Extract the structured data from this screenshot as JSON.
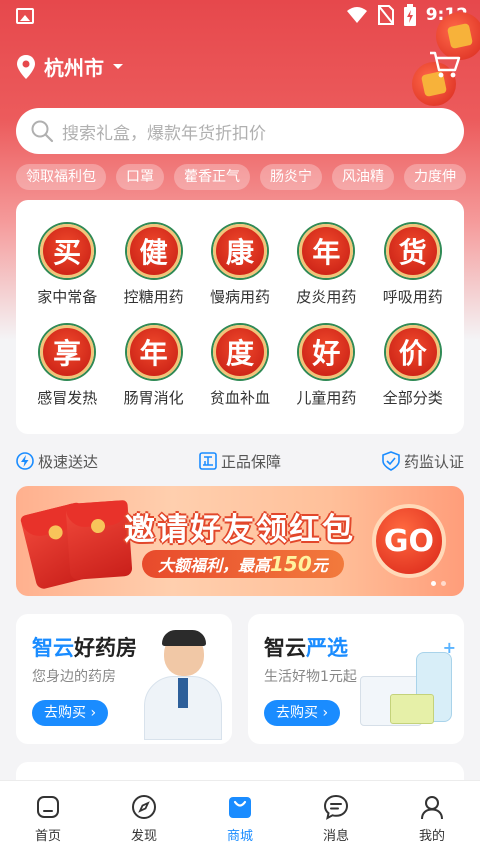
{
  "status_bar": {
    "time": "9:12"
  },
  "header": {
    "city": "杭州市"
  },
  "search": {
    "placeholder": "搜索礼盒，爆款年货折扣价"
  },
  "hot_tags": [
    "领取福利包",
    "口罩",
    "藿香正气",
    "肠炎宁",
    "风油精",
    "力度伸"
  ],
  "categories": [
    {
      "badge": "买",
      "label": "家中常备"
    },
    {
      "badge": "健",
      "label": "控糖用药"
    },
    {
      "badge": "康",
      "label": "慢病用药"
    },
    {
      "badge": "年",
      "label": "皮炎用药"
    },
    {
      "badge": "货",
      "label": "呼吸用药"
    },
    {
      "badge": "享",
      "label": "感冒发热"
    },
    {
      "badge": "年",
      "label": "肠胃消化"
    },
    {
      "badge": "度",
      "label": "贫血补血"
    },
    {
      "badge": "好",
      "label": "儿童用药"
    },
    {
      "badge": "价",
      "label": "全部分类"
    }
  ],
  "guarantees": [
    "极速送达",
    "正品保障",
    "药监认证"
  ],
  "banner": {
    "title": "邀请好友领红包",
    "subtitle_prefix": "大额福利，最高",
    "subtitle_amount": "150",
    "subtitle_unit": "元",
    "go_label": "GO"
  },
  "promos": [
    {
      "title_blue": "智云",
      "title_dark": "好药房",
      "desc": "您身边的药房",
      "button": "去购买"
    },
    {
      "title_dark": "智云",
      "title_blue": "严选",
      "desc": "生活好物1元起",
      "button": "去购买"
    }
  ],
  "tabs": [
    {
      "label": "首页",
      "icon": "home-icon"
    },
    {
      "label": "发现",
      "icon": "compass-icon"
    },
    {
      "label": "商城",
      "icon": "shopping-bag-icon"
    },
    {
      "label": "消息",
      "icon": "message-icon"
    },
    {
      "label": "我的",
      "icon": "user-icon"
    }
  ],
  "colors": {
    "accent": "#1a8cff",
    "brand_red": "#e6484c",
    "badge_red": "#c41a12"
  }
}
